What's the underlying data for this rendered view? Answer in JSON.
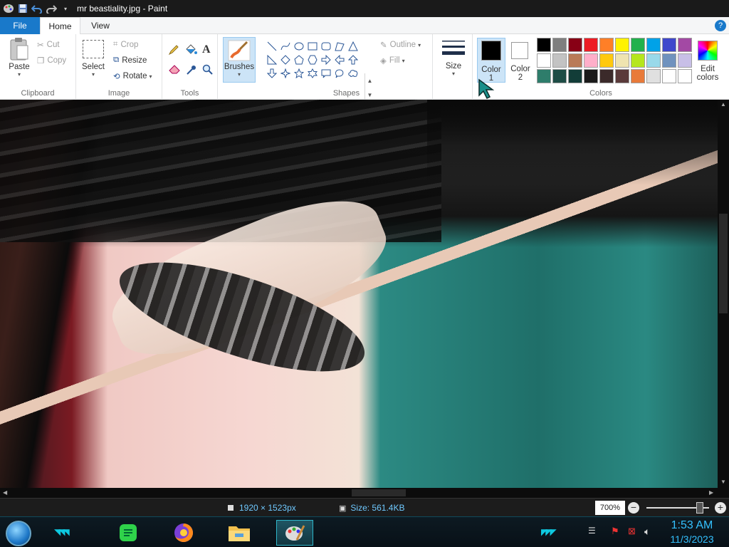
{
  "window": {
    "title": "mr beastiality.jpg - Paint"
  },
  "quick_access": {
    "icons": [
      "paint-logo-icon",
      "save-icon",
      "undo-icon",
      "redo-icon",
      "customize-icon"
    ]
  },
  "tabs": [
    {
      "label": "File"
    },
    {
      "label": "Home"
    },
    {
      "label": "View"
    }
  ],
  "ribbon": {
    "clipboard": {
      "paste": "Paste",
      "cut": "Cut",
      "copy": "Copy",
      "group_label": "Clipboard"
    },
    "image": {
      "select": "Select",
      "crop": "Crop",
      "resize": "Resize",
      "rotate": "Rotate",
      "group_label": "Image"
    },
    "tools": {
      "group_label": "Tools",
      "icons": [
        "pencil-icon",
        "fill-bucket-icon",
        "text-icon",
        "eraser-icon",
        "color-picker-icon",
        "magnifier-icon"
      ]
    },
    "brushes": {
      "label": "Brushes"
    },
    "shapes": {
      "outline": "Outline",
      "fill": "Fill",
      "group_label": "Shapes"
    },
    "size": {
      "label": "Size"
    },
    "colors": {
      "color1_line1": "Color",
      "color1_line2": "1",
      "color2_line1": "Color",
      "color2_line2": "2",
      "color1_value": "#000000",
      "color2_value": "#ffffff",
      "edit_line1": "Edit",
      "edit_line2": "colors",
      "group_label": "Colors",
      "palette": [
        "#000000",
        "#7f7f7f",
        "#880015",
        "#ed1c24",
        "#ff7f27",
        "#fff200",
        "#22b14c",
        "#00a2e8",
        "#3f48cc",
        "#a349a4",
        "#ffffff",
        "#c3c3c3",
        "#b97a57",
        "#ffaec9",
        "#ffc90e",
        "#efe4b0",
        "#b5e61d",
        "#99d9ea",
        "#7092be",
        "#c8bfe7",
        "#2e7d6b",
        "#1e4d45",
        "#123d38",
        "#1a1a1a",
        "#3b2a2a",
        "#5a3a3a",
        "#e87a3a",
        "#e0e0e0",
        "#ffffff",
        "#ffffff"
      ]
    }
  },
  "status": {
    "dimensions": "1920 × 1523px",
    "size": "Size: 561.4KB",
    "zoom": "700%"
  },
  "taskbar": {
    "apps": [
      {
        "name": "notes-app-icon"
      },
      {
        "name": "firefox-icon"
      },
      {
        "name": "file-explorer-icon"
      },
      {
        "name": "paint-app-icon"
      }
    ],
    "time": "1:53 AM",
    "date": "11/3/2023"
  }
}
